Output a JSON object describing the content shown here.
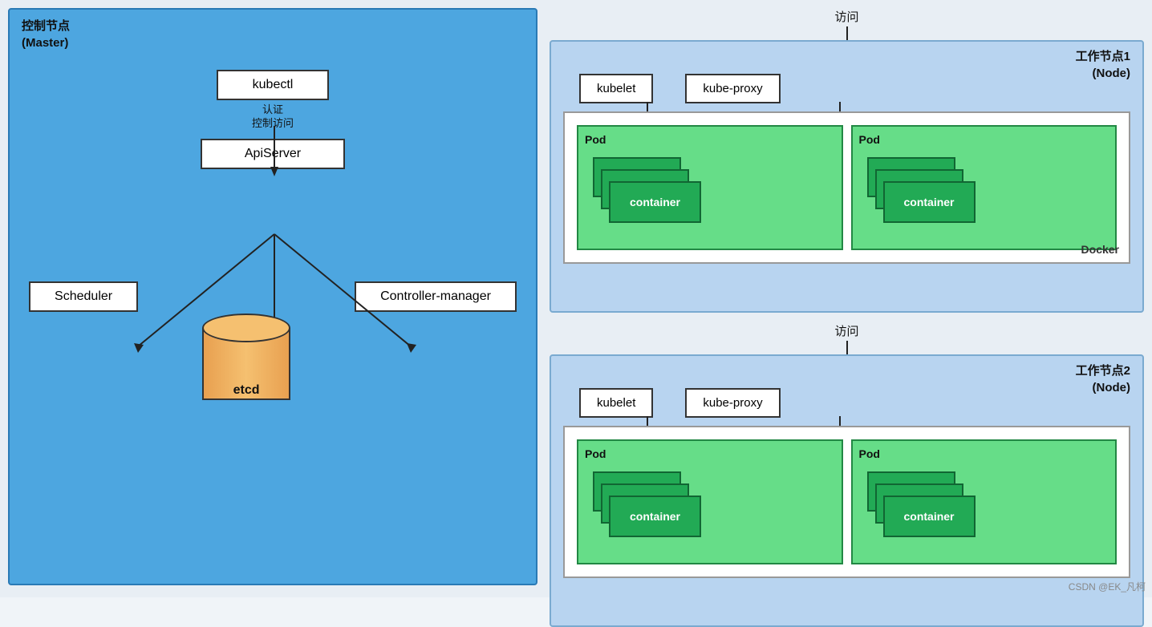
{
  "master": {
    "label_line1": "控制节点",
    "label_line2": "(Master)",
    "kubectl": "kubectl",
    "auth_label1": "认证",
    "auth_label2": "控制访问",
    "apiserver": "ApiServer",
    "scheduler": "Scheduler",
    "controller_manager": "Controller-manager",
    "etcd": "etcd"
  },
  "worker1": {
    "label_line1": "工作节点1",
    "label_line2": "(Node)",
    "visit": "访问",
    "kubelet": "kubelet",
    "kube_proxy": "kube-proxy",
    "docker_label": "Docker",
    "pod1": {
      "label": "Pod",
      "container": "container"
    },
    "pod2": {
      "label": "Pod",
      "container": "container"
    }
  },
  "worker2": {
    "label_line1": "工作节点2",
    "label_line2": "(Node)",
    "visit": "访问",
    "kubelet": "kubelet",
    "kube_proxy": "kube-proxy",
    "pod1": {
      "label": "Pod",
      "container": "container"
    },
    "pod2": {
      "label": "Pod",
      "container": "container"
    }
  },
  "watermark": "CSDN @EK_凡柯"
}
